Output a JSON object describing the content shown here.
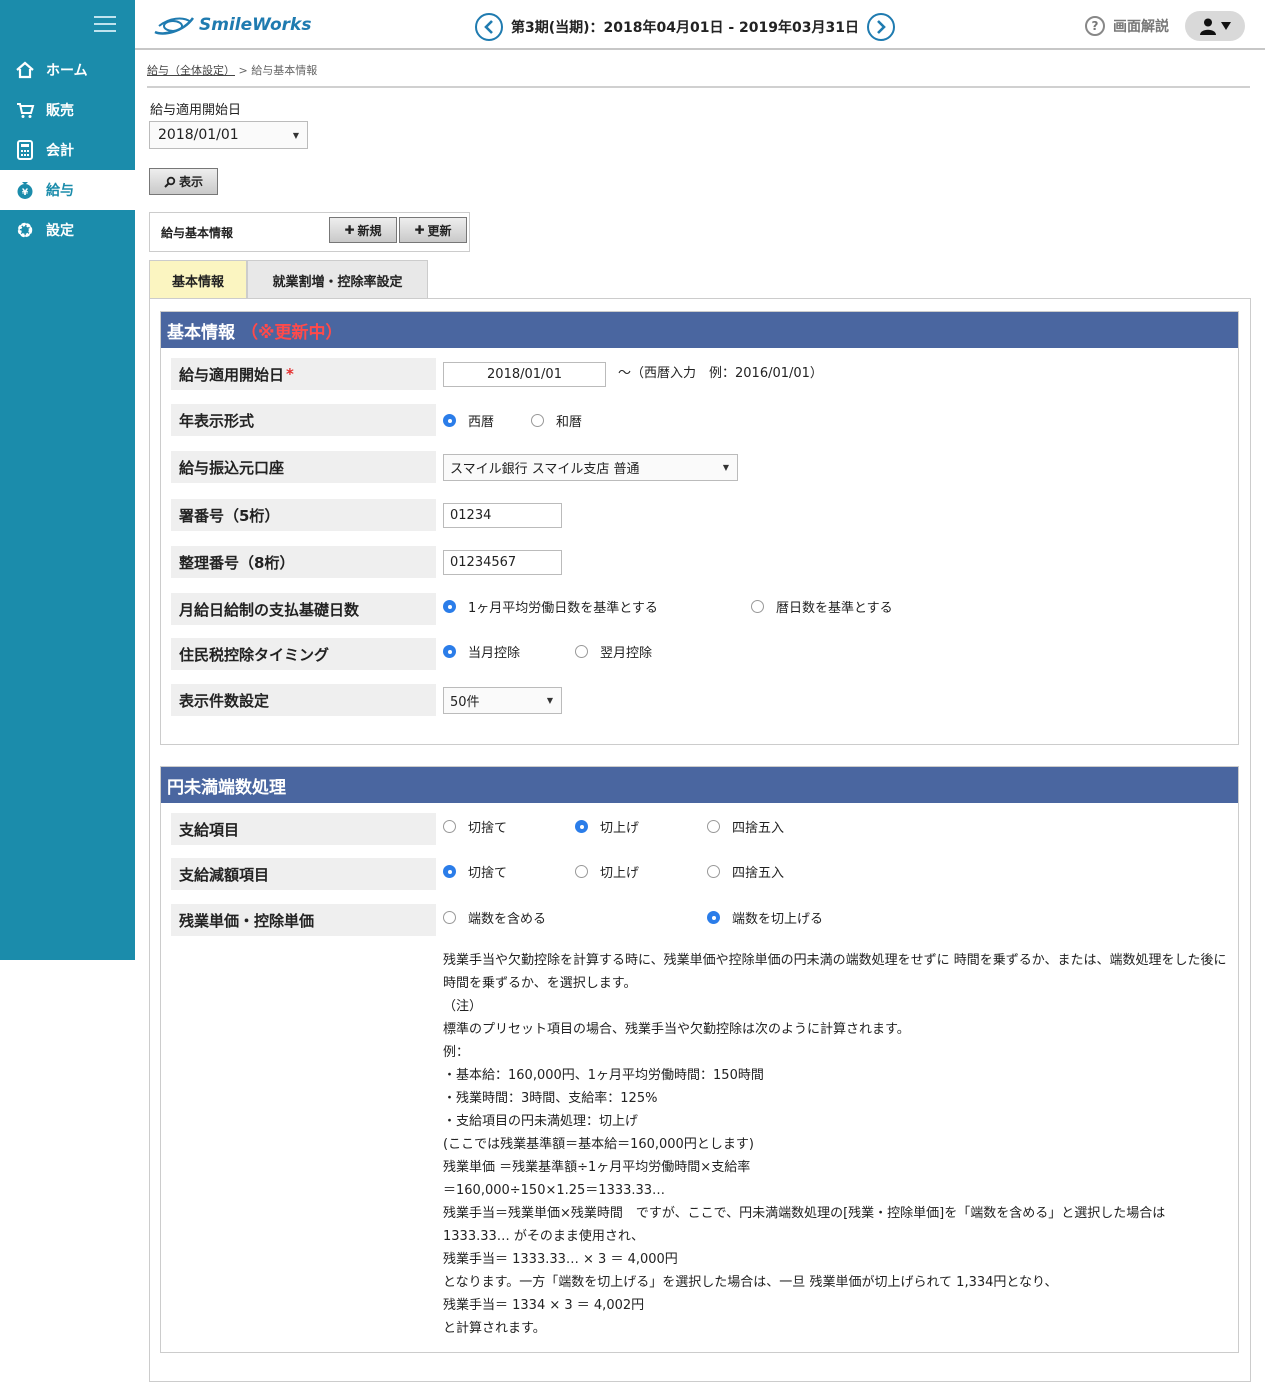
{
  "header": {
    "logo_text": "SmileWorks",
    "period": "第3期(当期)：2018年04月01日 - 2019年03月31日",
    "help_label": "画面解説"
  },
  "sidebar": {
    "items": [
      {
        "label": "ホーム",
        "icon": "home-icon"
      },
      {
        "label": "販売",
        "icon": "cart-icon"
      },
      {
        "label": "会計",
        "icon": "calculator-icon"
      },
      {
        "label": "給与",
        "icon": "yen-bag-icon",
        "active": true
      },
      {
        "label": "設定",
        "icon": "gear-icon"
      }
    ]
  },
  "breadcrumb": {
    "link": "給与（全体設定）",
    "separator": ">",
    "current": "給与基本情報"
  },
  "filter": {
    "label": "給与適用開始日",
    "selected": "2018/01/01",
    "show_button": "表示"
  },
  "toolbar": {
    "title": "給与基本情報",
    "new_button": "新規",
    "update_button": "更新"
  },
  "tabs": [
    {
      "label": "基本情報",
      "active": true
    },
    {
      "label": "就業割増・控除率設定",
      "active": false
    }
  ],
  "basic": {
    "title": "基本情報",
    "status": "（※更新中）",
    "rows": {
      "start_date": {
        "label": "給与適用開始日",
        "required": "*",
        "value": "2018/01/01",
        "hint": "～（西暦入力　例：2016/01/01）"
      },
      "year_format": {
        "label": "年表示形式",
        "options": [
          "西暦",
          "和暦"
        ],
        "selected": "西暦"
      },
      "bank": {
        "label": "給与振込元口座",
        "value": "スマイル銀行 スマイル支店 普通"
      },
      "office_no": {
        "label": "署番号（5桁）",
        "value": "01234"
      },
      "ref_no": {
        "label": "整理番号（8桁）",
        "value": "01234567"
      },
      "base_days": {
        "label": "月給日給制の支払基礎日数",
        "options": [
          "1ヶ月平均労働日数を基準とする",
          "暦日数を基準とする"
        ],
        "selected": "1ヶ月平均労働日数を基準とする"
      },
      "resident_tax": {
        "label": "住民税控除タイミング",
        "options": [
          "当月控除",
          "翌月控除"
        ],
        "selected": "当月控除"
      },
      "page_size": {
        "label": "表示件数設定",
        "value": "50件"
      }
    }
  },
  "rounding": {
    "title": "円未満端数処理",
    "rows": {
      "payment": {
        "label": "支給項目",
        "options": [
          "切捨て",
          "切上げ",
          "四捨五入"
        ],
        "selected": "切上げ"
      },
      "reduction": {
        "label": "支給減額項目",
        "options": [
          "切捨て",
          "切上げ",
          "四捨五入"
        ],
        "selected": "切捨て"
      },
      "overtime": {
        "label": "残業単価・控除単価",
        "options": [
          "端数を含める",
          "端数を切上げる"
        ],
        "selected": "端数を切上げる"
      }
    },
    "note_lines": [
      "残業手当や欠勤控除を計算する時に、残業単価や控除単価の円未満の端数処理をせずに 時間を乗ずるか、または、端数処理をした後に時間を乗ずるか、を選択します。",
      "（注）",
      "標準のプリセット項目の場合、残業手当や欠勤控除は次のように計算されます。",
      "例：",
      "・基本給：160,000円、1ヶ月平均労働時間：150時間",
      "・残業時間：3時間、支給率：125%",
      "・支給項目の円未満処理：切上げ",
      "(ここでは残業基準額＝基本給＝160,000円とします)",
      "残業単価 ＝残業基準額÷1ヶ月平均労働時間×支給率",
      "＝160,000÷150×1.25＝1333.33…",
      "残業手当＝残業単価×残業時間　ですが、ここで、円未満端数処理の[残業・控除単価]を「端数を含める」と選択した場合は 1333.33… がそのまま使用され、",
      "残業手当＝ 1333.33… × 3 ＝ 4,000円",
      "となります。一方「端数を切上げる」を選択した場合は、一旦 残業単価が切上げられて 1,334円となり、",
      "残業手当＝ 1334 × 3 ＝ 4,002円",
      "と計算されます。"
    ]
  }
}
